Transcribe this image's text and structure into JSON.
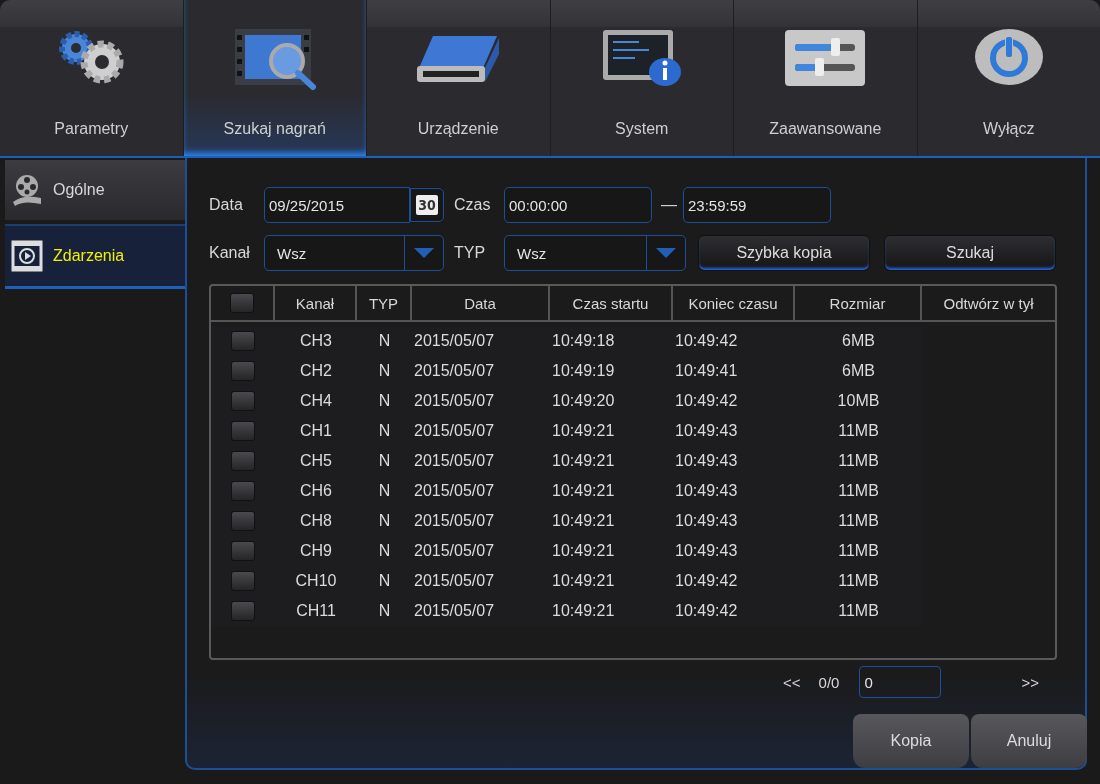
{
  "top_tabs": [
    {
      "label": "Parametry",
      "selected": false
    },
    {
      "label": "Szukaj nagrań",
      "selected": true
    },
    {
      "label": "Urządzenie",
      "selected": false
    },
    {
      "label": "System",
      "selected": false
    },
    {
      "label": "Zaawansowane",
      "selected": false
    },
    {
      "label": "Wyłącz",
      "selected": false
    }
  ],
  "sidebar": {
    "items": [
      {
        "label": "Ogólne",
        "selected": false
      },
      {
        "label": "Zdarzenia",
        "selected": true
      }
    ]
  },
  "filters": {
    "date_label": "Data",
    "date": "09/25/2015",
    "calendar_day": "30",
    "time_label": "Czas",
    "time_from": "00:00:00",
    "dash": "—",
    "time_to": "23:59:59",
    "channel_label": "Kanał",
    "channel": "Wsz",
    "type_label": "TYP",
    "type": "Wsz"
  },
  "buttons": [
    "Szybka kopia",
    "Szukaj"
  ],
  "table": {
    "select_all_checked": false,
    "columns": [
      "Kanał",
      "TYP",
      "Data",
      "Czas startu",
      "Koniec czasu",
      "Rozmiar",
      "Odtwórz w tył"
    ],
    "rows": [
      {
        "checked": false,
        "cells": [
          "CH3",
          "N",
          "2015/05/07",
          "10:49:18",
          "10:49:42",
          "6MB"
        ]
      },
      {
        "checked": false,
        "cells": [
          "CH2",
          "N",
          "2015/05/07",
          "10:49:19",
          "10:49:41",
          "6MB"
        ]
      },
      {
        "checked": false,
        "cells": [
          "CH4",
          "N",
          "2015/05/07",
          "10:49:20",
          "10:49:42",
          "10MB"
        ]
      },
      {
        "checked": false,
        "cells": [
          "CH1",
          "N",
          "2015/05/07",
          "10:49:21",
          "10:49:43",
          "11MB"
        ]
      },
      {
        "checked": false,
        "cells": [
          "CH5",
          "N",
          "2015/05/07",
          "10:49:21",
          "10:49:43",
          "11MB"
        ]
      },
      {
        "checked": false,
        "cells": [
          "CH6",
          "N",
          "2015/05/07",
          "10:49:21",
          "10:49:43",
          "11MB"
        ]
      },
      {
        "checked": false,
        "cells": [
          "CH8",
          "N",
          "2015/05/07",
          "10:49:21",
          "10:49:43",
          "11MB"
        ]
      },
      {
        "checked": false,
        "cells": [
          "CH9",
          "N",
          "2015/05/07",
          "10:49:21",
          "10:49:43",
          "11MB"
        ]
      },
      {
        "checked": false,
        "cells": [
          "CH10",
          "N",
          "2015/05/07",
          "10:49:21",
          "10:49:42",
          "11MB"
        ]
      },
      {
        "checked": false,
        "cells": [
          "CH11",
          "N",
          "2015/05/07",
          "10:49:21",
          "10:49:42",
          "11MB"
        ]
      }
    ]
  },
  "pager": {
    "prev": "<<",
    "page": "0/0",
    "page_input": "0",
    "next": ">>"
  },
  "footer_buttons": [
    "Kopia",
    "Anuluj"
  ]
}
